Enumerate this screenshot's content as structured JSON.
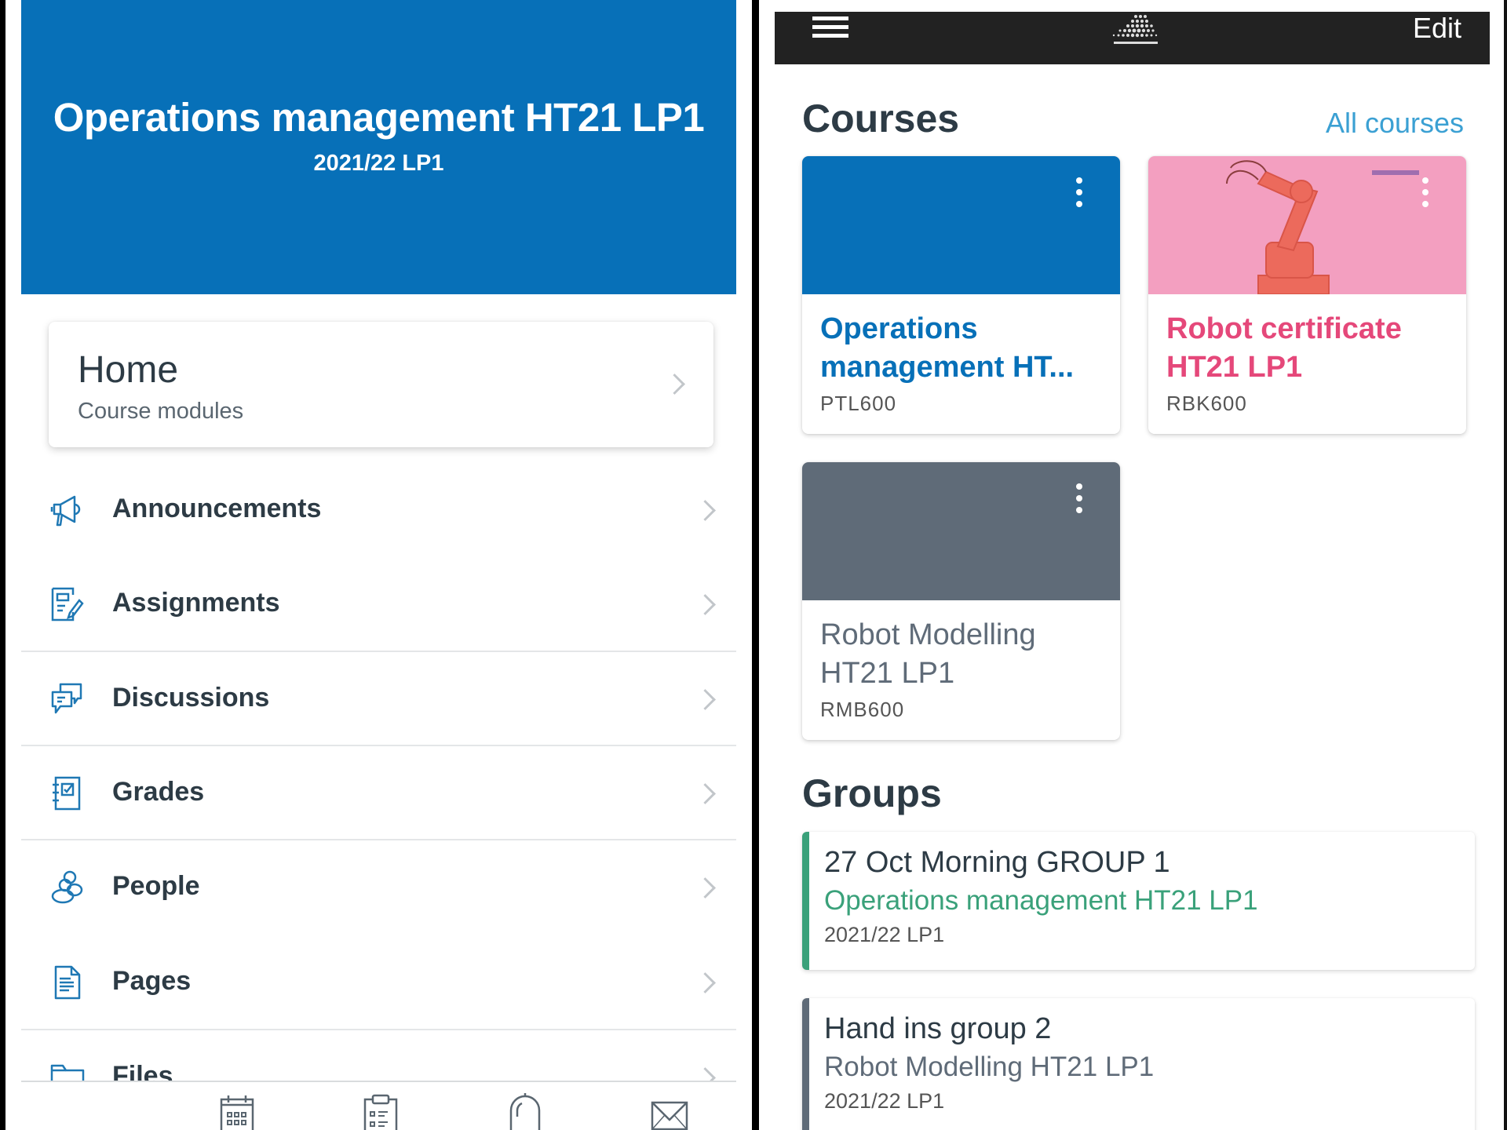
{
  "left_screen": {
    "course_header": {
      "title": "Operations management HT21 LP1",
      "term": "2021/22 LP1",
      "color": "#0770b8"
    },
    "home_card": {
      "title": "Home",
      "subtitle": "Course modules",
      "icon": "chevron-right-icon"
    },
    "menu": [
      {
        "label": "Announcements",
        "icon": "megaphone-icon"
      },
      {
        "label": "Assignments",
        "icon": "assignment-icon"
      },
      {
        "label": "Discussions",
        "icon": "discussion-icon"
      },
      {
        "label": "Grades",
        "icon": "gradebook-icon"
      },
      {
        "label": "People",
        "icon": "people-icon"
      },
      {
        "label": "Pages",
        "icon": "document-icon"
      },
      {
        "label": "Files",
        "icon": "folder-icon"
      }
    ],
    "tab_bar": [
      {
        "name": "calendar",
        "icon": "calendar-icon"
      },
      {
        "name": "todo",
        "icon": "clipboard-icon"
      },
      {
        "name": "notifications",
        "icon": "bell-icon"
      },
      {
        "name": "inbox",
        "icon": "mail-icon"
      }
    ]
  },
  "right_screen": {
    "top_bar": {
      "menu_icon": "hamburger-icon",
      "logo": "university-logo",
      "edit_label": "Edit"
    },
    "courses_section": {
      "title": "Courses",
      "all_courses_label": "All courses",
      "cards": [
        {
          "title": "Operations management HT...",
          "code": "PTL600",
          "color": "#0770b8",
          "image": "solid"
        },
        {
          "title": "Robot certificate HT21 LP1",
          "code": "RBK600",
          "color": "#e5487a",
          "image": "robot-arm"
        },
        {
          "title": "Robot Modelling HT21 LP1",
          "code": "RMB600",
          "color": "#5f6b78",
          "image": "solid"
        }
      ]
    },
    "groups_section": {
      "title": "Groups",
      "groups": [
        {
          "name": "27 Oct Morning GROUP 1",
          "course": "Operations management HT21 LP1",
          "term": "2021/22 LP1",
          "color": "#3aa17a"
        },
        {
          "name": "Hand ins group 2",
          "course": "Robot Modelling HT21 LP1",
          "term": "2021/22 LP1",
          "color": "#5f6b78"
        }
      ]
    }
  }
}
